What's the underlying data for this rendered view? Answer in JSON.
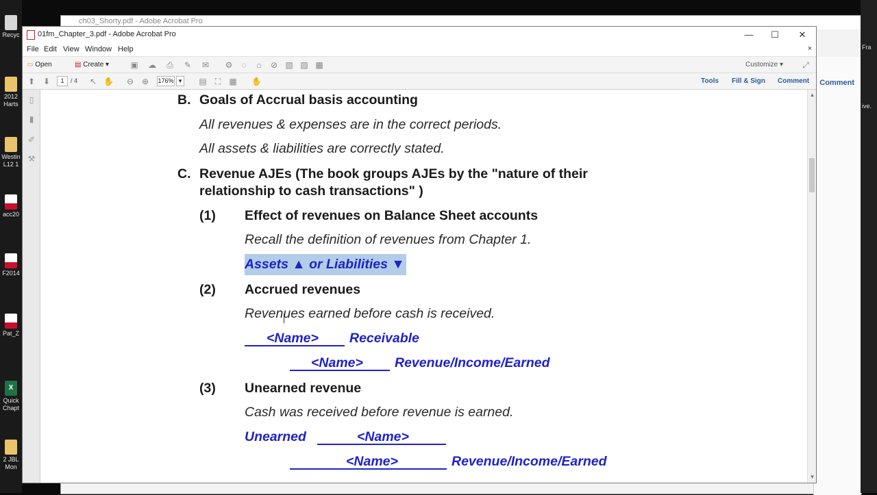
{
  "desktop": {
    "left_icons": [
      {
        "label": "Recyc"
      },
      {
        "label": "2012\nHarts"
      },
      {
        "label": "Westin\nL12 1"
      },
      {
        "label": "acc20"
      },
      {
        "label": "F2014"
      },
      {
        "label": "Pat_Z"
      },
      {
        "label": "Quick\nChapt"
      },
      {
        "label": "2 JBL\nMon"
      }
    ],
    "right_labels": [
      "Fra",
      "ive."
    ]
  },
  "background_window": {
    "title": "ch03_Shorty.pdf - Adobe Acrobat Pro",
    "comment_label": "Comment"
  },
  "window": {
    "title": "01fm_Chapter_3.pdf - Adobe Acrobat Pro",
    "minimize": "—",
    "maximize": "☐",
    "close": "✕"
  },
  "menu": {
    "items": [
      "File",
      "Edit",
      "View",
      "Window",
      "Help"
    ],
    "close": "×"
  },
  "toolbar": {
    "open_label": "Open",
    "create_label": "Create",
    "customize_label": "Customize"
  },
  "toolbar2": {
    "page_current": "1",
    "page_total": "/ 4",
    "zoom": "176%",
    "tools_label": "Tools",
    "fill_sign_label": "Fill & Sign",
    "comment_label": "Comment"
  },
  "document": {
    "sectionB": {
      "letter": "B.",
      "heading": "Goals of Accrual basis accounting",
      "line1": "All revenues & expenses are in the correct periods.",
      "line2": "All assets & liabilities are correctly stated."
    },
    "sectionC": {
      "letter": "C.",
      "heading_line1": "Revenue AJEs (The book groups AJEs by the \"nature of their",
      "heading_line2": "relationship to cash transactions\" )"
    },
    "item1": {
      "num": "(1)",
      "heading": "Effect of revenues on Balance Sheet accounts",
      "line1": "Recall the definition of revenues from Chapter 1.",
      "highlight": "Assets ▲ or Liabilities ▼"
    },
    "item2": {
      "num": "(2)",
      "heading": "Accrued revenues",
      "line1": "Revenues earned before cash is received.",
      "entry1_name": "<Name>",
      "entry1_account": "Receivable",
      "entry2_name": "<Name>",
      "entry2_account": "Revenue/Income/Earned"
    },
    "item3": {
      "num": "(3)",
      "heading": "Unearned revenue",
      "line1": "Cash was received before revenue is earned.",
      "entry1_prefix": "Unearned",
      "entry1_name": "<Name>",
      "entry2_name": "<Name>",
      "entry2_account": "Revenue/Income/Earned"
    }
  }
}
